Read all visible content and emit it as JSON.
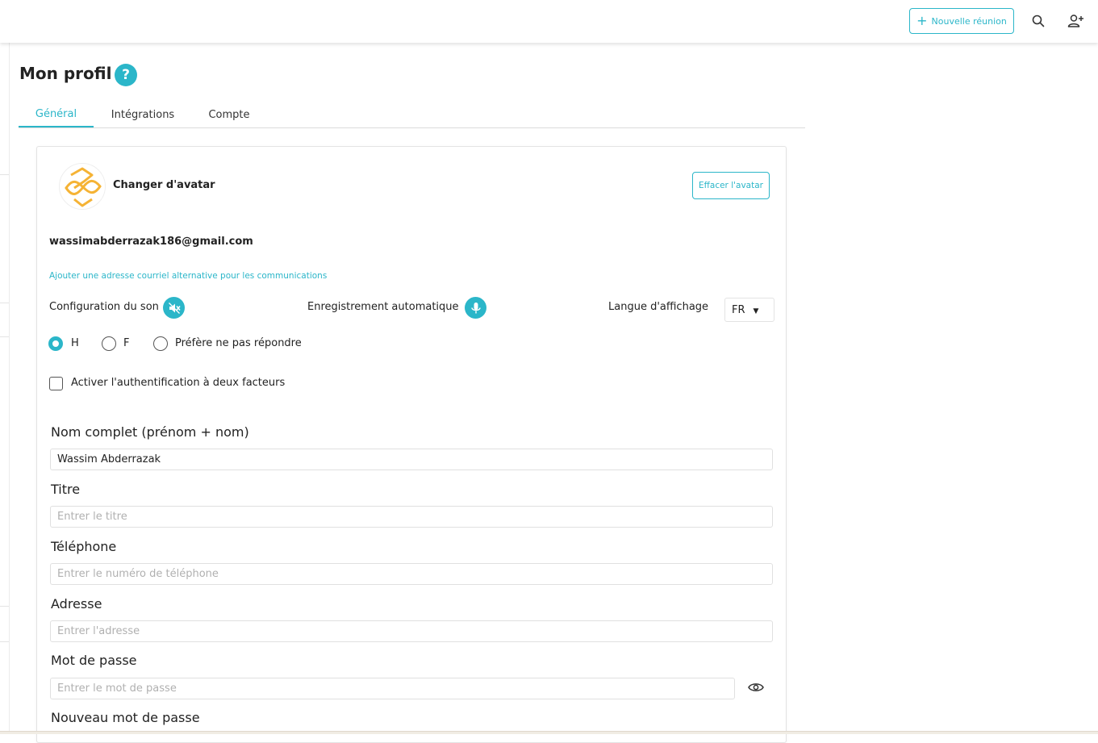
{
  "topbar": {
    "new_meeting_label": "Nouvelle réunion",
    "search_icon": "search-icon",
    "add_user_icon": "add-user-icon"
  },
  "page": {
    "title": "Mon profil",
    "help_icon": "?"
  },
  "tabs": [
    {
      "label": "Général",
      "active": true
    },
    {
      "label": "Intégrations",
      "active": false
    },
    {
      "label": "Compte",
      "active": false
    }
  ],
  "profile": {
    "change_avatar_label": "Changer d'avatar",
    "clear_avatar_label": "Effacer l'avatar",
    "email": "wassimabderrazak186@gmail.com",
    "alt_email_link": "Ajouter une adresse courriel alternative pour les communications",
    "sound_config_label": "Configuration du son",
    "auto_record_label": "Enregistrement automatique",
    "display_language_label": "Langue d'affichage",
    "display_language_value": "FR",
    "gender_options": [
      {
        "label": "H",
        "checked": true
      },
      {
        "label": "F",
        "checked": false
      },
      {
        "label": "Préfère ne pas répondre",
        "checked": false
      }
    ],
    "two_factor_label": "Activer l'authentification à deux facteurs",
    "two_factor_checked": false
  },
  "fields": {
    "full_name": {
      "label": "Nom complet (prénom + nom)",
      "value": "Wassim Abderrazak",
      "placeholder": ""
    },
    "title": {
      "label": "Titre",
      "value": "",
      "placeholder": "Entrer le titre"
    },
    "phone": {
      "label": "Téléphone",
      "value": "",
      "placeholder": "Entrer le numéro de téléphone"
    },
    "address": {
      "label": "Adresse",
      "value": "",
      "placeholder": "Entrer l'adresse"
    },
    "password": {
      "label": "Mot de passe",
      "value": "",
      "placeholder": "Entrer le mot de passe"
    },
    "new_password": {
      "label": "Nouveau mot de passe"
    }
  },
  "colors": {
    "accent": "#2bb6c9",
    "avatar_logo": "#f5b335"
  }
}
